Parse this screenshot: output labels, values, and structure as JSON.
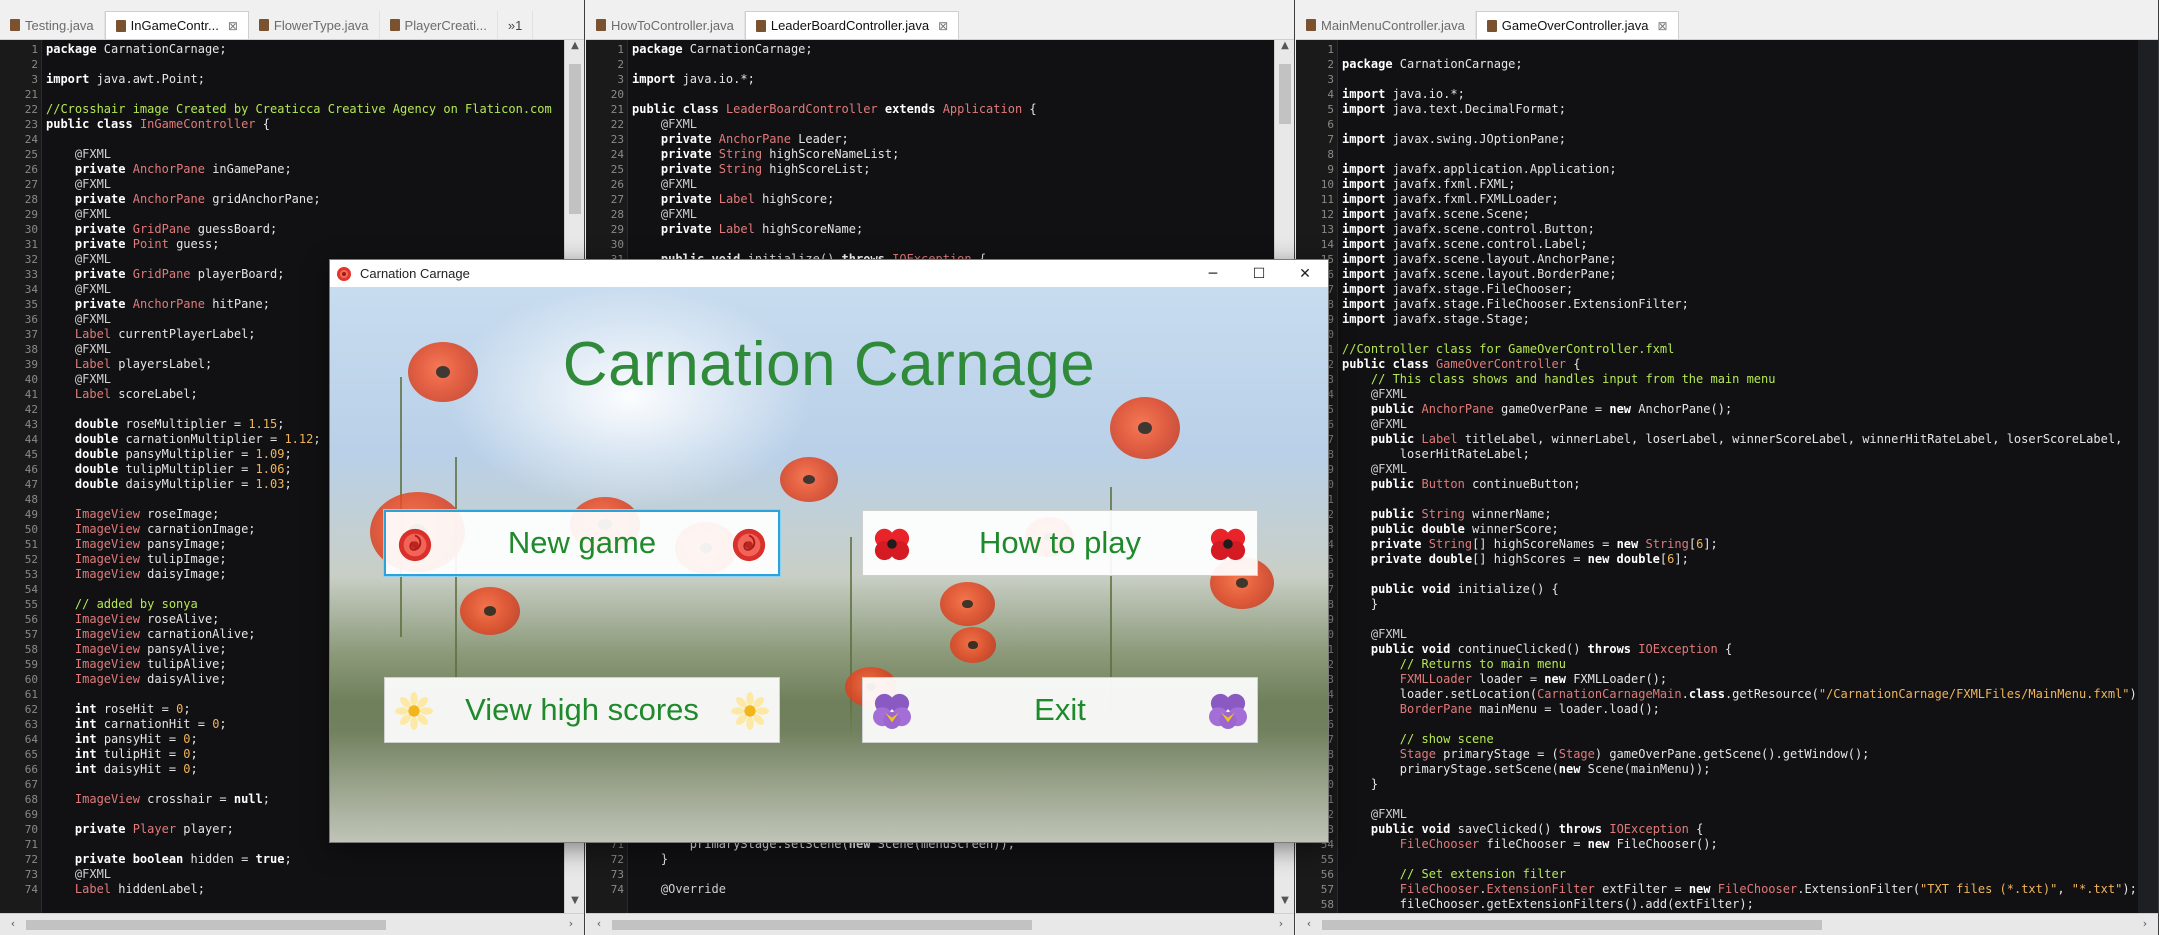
{
  "panes": [
    {
      "tabs": [
        {
          "label": "Testing.java",
          "active": false,
          "closable": false
        },
        {
          "label": "InGameContr...",
          "active": true,
          "closable": true
        },
        {
          "label": "FlowerType.java",
          "active": false,
          "closable": false
        },
        {
          "label": "PlayerCreati...",
          "active": false,
          "closable": false
        },
        {
          "label": "»1",
          "active": false,
          "closable": false,
          "overflow": true
        }
      ],
      "lines": [
        [
          "1",
          "<span class='kw'>package</span> CarnationCarnage;"
        ],
        [
          "2",
          ""
        ],
        [
          "3",
          "<span class='kw'>import</span> java.awt.Point;"
        ],
        [
          "21",
          ""
        ],
        [
          "22",
          "<span class='cm'>//Crosshair image Created by Creaticca Creative Agency on Flaticon.com</span>"
        ],
        [
          "23",
          "<span class='kw'>public class</span> <span class='ty'>InGameController</span> {"
        ],
        [
          "24",
          ""
        ],
        [
          "25",
          "    <span class='an'>@FXML</span>"
        ],
        [
          "26",
          "    <span class='kw'>private</span> <span class='ty'>AnchorPane</span> inGamePane;"
        ],
        [
          "27",
          "    <span class='an'>@FXML</span>"
        ],
        [
          "28",
          "    <span class='kw'>private</span> <span class='ty'>AnchorPane</span> gridAnchorPane;"
        ],
        [
          "29",
          "    <span class='an'>@FXML</span>"
        ],
        [
          "30",
          "    <span class='kw'>private</span> <span class='ty'>GridPane</span> guessBoard;"
        ],
        [
          "31",
          "    <span class='kw'>private</span> <span class='ty'>Point</span> guess;"
        ],
        [
          "32",
          "    <span class='an'>@FXML</span>"
        ],
        [
          "33",
          "    <span class='kw'>private</span> <span class='ty'>GridPane</span> playerBoard;"
        ],
        [
          "34",
          "    <span class='an'>@FXML</span>"
        ],
        [
          "35",
          "    <span class='kw'>private</span> <span class='ty'>AnchorPane</span> hitPane;"
        ],
        [
          "36",
          "    <span class='an'>@FXML</span>"
        ],
        [
          "37",
          "    <span class='ty'>Label</span> currentPlayerLabel;"
        ],
        [
          "38",
          "    <span class='an'>@FXML</span>"
        ],
        [
          "39",
          "    <span class='ty'>Label</span> playersLabel;"
        ],
        [
          "40",
          "    <span class='an'>@FXML</span>"
        ],
        [
          "41",
          "    <span class='ty'>Label</span> scoreLabel;"
        ],
        [
          "42",
          ""
        ],
        [
          "43",
          "    <span class='kw'>double</span> roseMultiplier = <span class='st'>1.15</span>;"
        ],
        [
          "44",
          "    <span class='kw'>double</span> carnationMultiplier = <span class='st'>1.12</span>;"
        ],
        [
          "45",
          "    <span class='kw'>double</span> pansyMultiplier = <span class='st'>1.09</span>;"
        ],
        [
          "46",
          "    <span class='kw'>double</span> tulipMultiplier = <span class='st'>1.06</span>;"
        ],
        [
          "47",
          "    <span class='kw'>double</span> daisyMultiplier = <span class='st'>1.03</span>;"
        ],
        [
          "48",
          ""
        ],
        [
          "49",
          "    <span class='ty'>ImageView</span> roseImage;"
        ],
        [
          "50",
          "    <span class='ty'>ImageView</span> carnationImage;"
        ],
        [
          "51",
          "    <span class='ty'>ImageView</span> pansyImage;"
        ],
        [
          "52",
          "    <span class='ty'>ImageView</span> tulipImage;"
        ],
        [
          "53",
          "    <span class='ty'>ImageView</span> daisyImage;"
        ],
        [
          "54",
          ""
        ],
        [
          "55",
          "    <span class='cm'>// added by sonya</span>"
        ],
        [
          "56",
          "    <span class='ty'>ImageView</span> roseAlive;"
        ],
        [
          "57",
          "    <span class='ty'>ImageView</span> carnationAlive;"
        ],
        [
          "58",
          "    <span class='ty'>ImageView</span> pansyAlive;"
        ],
        [
          "59",
          "    <span class='ty'>ImageView</span> tulipAlive;"
        ],
        [
          "60",
          "    <span class='ty'>ImageView</span> daisyAlive;"
        ],
        [
          "61",
          ""
        ],
        [
          "62",
          "    <span class='kw'>int</span> roseHit = <span class='st'>0</span>;"
        ],
        [
          "63",
          "    <span class='kw'>int</span> carnationHit = <span class='st'>0</span>;"
        ],
        [
          "64",
          "    <span class='kw'>int</span> pansyHit = <span class='st'>0</span>;"
        ],
        [
          "65",
          "    <span class='kw'>int</span> tulipHit = <span class='st'>0</span>;"
        ],
        [
          "66",
          "    <span class='kw'>int</span> daisyHit = <span class='st'>0</span>;"
        ],
        [
          "67",
          ""
        ],
        [
          "68",
          "    <span class='ty'>ImageView</span> crosshair = <span class='kw'>null</span>;"
        ],
        [
          "69",
          ""
        ],
        [
          "70",
          "    <span class='kw'>private</span> <span class='ty'>Player</span> player;"
        ],
        [
          "71",
          ""
        ],
        [
          "72",
          "    <span class='kw'>private boolean</span> hidden = <span class='kw'>true</span>;"
        ],
        [
          "73",
          "    <span class='an'>@FXML</span>"
        ],
        [
          "74",
          "    <span class='ty'>Label</span> hiddenLabel;"
        ]
      ]
    },
    {
      "tabs": [
        {
          "label": "HowToController.java",
          "active": false,
          "closable": false
        },
        {
          "label": "LeaderBoardController.java",
          "active": true,
          "closable": true
        }
      ],
      "lines": [
        [
          "1",
          "<span class='kw'>package</span> CarnationCarnage;"
        ],
        [
          "2",
          ""
        ],
        [
          "3",
          "<span class='kw'>import</span> java.io.*;"
        ],
        [
          "20",
          ""
        ],
        [
          "21",
          "<span class='kw'>public class</span> <span class='ty'>LeaderBoardController</span> <span class='kw'>extends</span> <span class='ty'>Application</span> {"
        ],
        [
          "22",
          "    <span class='an'>@FXML</span>"
        ],
        [
          "23",
          "    <span class='kw'>private</span> <span class='ty'>AnchorPane</span> Leader;"
        ],
        [
          "24",
          "    <span class='kw'>private</span> <span class='ty'>String</span> highScoreNameList;"
        ],
        [
          "25",
          "    <span class='kw'>private</span> <span class='ty'>String</span> highScoreList;"
        ],
        [
          "26",
          "    <span class='an'>@FXML</span>"
        ],
        [
          "27",
          "    <span class='kw'>private</span> <span class='ty'>Label</span> highScore;"
        ],
        [
          "28",
          "    <span class='an'>@FXML</span>"
        ],
        [
          "29",
          "    <span class='kw'>private</span> <span class='ty'>Label</span> highScoreName;"
        ],
        [
          "30",
          ""
        ],
        [
          "31",
          "    <span class='kw'>public void</span> initialize() <span class='kw'>throws</span> <span class='ty'>IOException</span> {"
        ],
        [
          "",
          ""
        ],
        [
          "",
          ""
        ],
        [
          "",
          ""
        ],
        [
          "",
          ""
        ],
        [
          "",
          ""
        ],
        [
          "",
          ""
        ],
        [
          "",
          ""
        ],
        [
          "",
          ""
        ],
        [
          "",
          ""
        ],
        [
          "",
          ""
        ],
        [
          "",
          ""
        ],
        [
          "",
          ""
        ],
        [
          "",
          ""
        ],
        [
          "",
          ""
        ],
        [
          "",
          ""
        ],
        [
          "",
          ""
        ],
        [
          "",
          ""
        ],
        [
          "",
          ""
        ],
        [
          "",
          ""
        ],
        [
          "",
          ""
        ],
        [
          "",
          ""
        ],
        [
          "",
          ""
        ],
        [
          "",
          ""
        ],
        [
          "",
          ""
        ],
        [
          "",
          ""
        ],
        [
          "",
          ""
        ],
        [
          "",
          ""
        ],
        [
          "",
          ""
        ],
        [
          "",
          ""
        ],
        [
          "",
          ""
        ],
        [
          "",
          ""
        ],
        [
          "",
          ""
        ],
        [
          "",
          ""
        ],
        [
          "",
          ""
        ],
        [
          "",
          ""
        ],
        [
          "",
          ""
        ],
        [
          "",
          ""
        ],
        [
          "",
          ""
        ],
        [
          "71",
          "        primaryStage.setScene(<span class='kw'>new</span> Scene(menuScreen));"
        ],
        [
          "72",
          "    }"
        ],
        [
          "73",
          ""
        ],
        [
          "74",
          "    <span class='an'>@Override</span>"
        ]
      ]
    },
    {
      "tabs": [
        {
          "label": "MainMenuController.java",
          "active": false,
          "closable": false
        },
        {
          "label": "GameOverController.java",
          "active": true,
          "closable": true
        }
      ],
      "lines": [
        [
          "1",
          ""
        ],
        [
          "2",
          "<span class='kw'>package</span> CarnationCarnage;"
        ],
        [
          "3",
          ""
        ],
        [
          "4",
          "<span class='kw'>import</span> java.io.*;"
        ],
        [
          "5",
          "<span class='kw'>import</span> java.text.DecimalFormat;"
        ],
        [
          "6",
          ""
        ],
        [
          "7",
          "<span class='kw'>import</span> javax.swing.JOptionPane;"
        ],
        [
          "8",
          ""
        ],
        [
          "9",
          "<span class='kw'>import</span> javafx.application.Application;"
        ],
        [
          "10",
          "<span class='kw'>import</span> javafx.fxml.FXML;"
        ],
        [
          "11",
          "<span class='kw'>import</span> javafx.fxml.FXMLLoader;"
        ],
        [
          "12",
          "<span class='kw'>import</span> javafx.scene.Scene;"
        ],
        [
          "13",
          "<span class='kw'>import</span> javafx.scene.control.Button;"
        ],
        [
          "14",
          "<span class='kw'>import</span> javafx.scene.control.Label;"
        ],
        [
          "15",
          "<span class='kw'>import</span> javafx.scene.layout.AnchorPane;"
        ],
        [
          "16",
          "<span class='kw'>import</span> javafx.scene.layout.BorderPane;"
        ],
        [
          "17",
          "<span class='kw'>import</span> javafx.stage.FileChooser;"
        ],
        [
          "18",
          "<span class='kw'>import</span> javafx.stage.FileChooser.ExtensionFilter;"
        ],
        [
          "19",
          "<span class='kw'>import</span> javafx.stage.Stage;"
        ],
        [
          "20",
          ""
        ],
        [
          "21",
          "<span class='cm'>//Controller class for GameOverController.fxml</span>"
        ],
        [
          "22",
          "<span class='kw'>public class</span> <span class='ty'>GameOverController</span> {"
        ],
        [
          "23",
          "    <span class='cm'>// This class shows and handles input from the main menu</span>"
        ],
        [
          "24",
          "    <span class='an'>@FXML</span>"
        ],
        [
          "25",
          "    <span class='kw'>public</span> <span class='ty'>AnchorPane</span> gameOverPane = <span class='kw'>new</span> AnchorPane();"
        ],
        [
          "26",
          "    <span class='an'>@FXML</span>"
        ],
        [
          "27",
          "    <span class='kw'>public</span> <span class='ty'>Label</span> titleLabel, winnerLabel, loserLabel, winnerScoreLabel, winnerHitRateLabel, loserScoreLabel,"
        ],
        [
          "28",
          "        loserHitRateLabel;"
        ],
        [
          "29",
          "    <span class='an'>@FXML</span>"
        ],
        [
          "30",
          "    <span class='kw'>public</span> <span class='ty'>Button</span> continueButton;"
        ],
        [
          "31",
          ""
        ],
        [
          "32",
          "    <span class='kw'>public</span> <span class='ty'>String</span> winnerName;"
        ],
        [
          "33",
          "    <span class='kw'>public double</span> winnerScore;"
        ],
        [
          "34",
          "    <span class='kw'>private</span> <span class='ty'>String</span>[] highScoreNames = <span class='kw'>new</span> <span class='ty'>String</span>[<span class='st'>6</span>];"
        ],
        [
          "35",
          "    <span class='kw'>private double</span>[] highScores = <span class='kw'>new double</span>[<span class='st'>6</span>];"
        ],
        [
          "36",
          ""
        ],
        [
          "37",
          "    <span class='kw'>public void</span> initialize() {"
        ],
        [
          "38",
          "    }"
        ],
        [
          "39",
          ""
        ],
        [
          "40",
          "    <span class='an'>@FXML</span>"
        ],
        [
          "41",
          "    <span class='kw'>public void</span> continueClicked() <span class='kw'>throws</span> <span class='ty'>IOException</span> {"
        ],
        [
          "42",
          "        <span class='cm'>// Returns to main menu</span>"
        ],
        [
          "43",
          "        <span class='ty'>FXMLLoader</span> loader = <span class='kw'>new</span> FXMLLoader();"
        ],
        [
          "44",
          "        loader.setLocation(<span class='ty'>CarnationCarnageMain</span>.<span class='kw'>class</span>.getResource(<span class='st'>\"/CarnationCarnage/FXMLFiles/MainMenu.fxml\"</span>));"
        ],
        [
          "45",
          "        <span class='ty'>BorderPane</span> mainMenu = loader.load();"
        ],
        [
          "46",
          ""
        ],
        [
          "47",
          "        <span class='cm'>// show scene</span>"
        ],
        [
          "48",
          "        <span class='ty'>Stage</span> primaryStage = (<span class='ty'>Stage</span>) gameOverPane.getScene().getWindow();"
        ],
        [
          "49",
          "        primaryStage.setScene(<span class='kw'>new</span> Scene(mainMenu));"
        ],
        [
          "50",
          "    }"
        ],
        [
          "51",
          ""
        ],
        [
          "52",
          "    <span class='an'>@FXML</span>"
        ],
        [
          "53",
          "    <span class='kw'>public void</span> saveClicked() <span class='kw'>throws</span> <span class='ty'>IOException</span> {"
        ],
        [
          "54",
          "        <span class='ty'>FileChooser</span> fileChooser = <span class='kw'>new</span> FileChooser();"
        ],
        [
          "55",
          ""
        ],
        [
          "56",
          "        <span class='cm'>// Set extension filter</span>"
        ],
        [
          "57",
          "        <span class='ty'>FileChooser</span>.<span class='ty'>ExtensionFilter</span> extFilter = <span class='kw'>new</span> <span class='ty'>FileChooser</span>.ExtensionFilter(<span class='st'>\"TXT files (*.txt)\"</span>, <span class='st'>\"*.txt\"</span>);"
        ],
        [
          "58",
          "        fileChooser.getExtensionFilters().add(extFilter);"
        ]
      ]
    }
  ],
  "app_window": {
    "title": "Carnation Carnage",
    "controls": {
      "minimize": "─",
      "maximize": "☐",
      "close": "✕"
    },
    "heading": "Carnation Carnage",
    "buttons": {
      "new_game": "New game",
      "how_to_play": "How to play",
      "view_high_scores": "View high scores",
      "exit": "Exit"
    },
    "button_icons": {
      "new_game": "rose-icon",
      "how_to_play": "poppy-icon",
      "view_high_scores": "daisy-icon",
      "exit": "pansy-icon"
    },
    "colors": {
      "title_green": "#2f8a3a",
      "button_text": "#1f8a2c",
      "focus_ring": "#29a3d9"
    }
  }
}
